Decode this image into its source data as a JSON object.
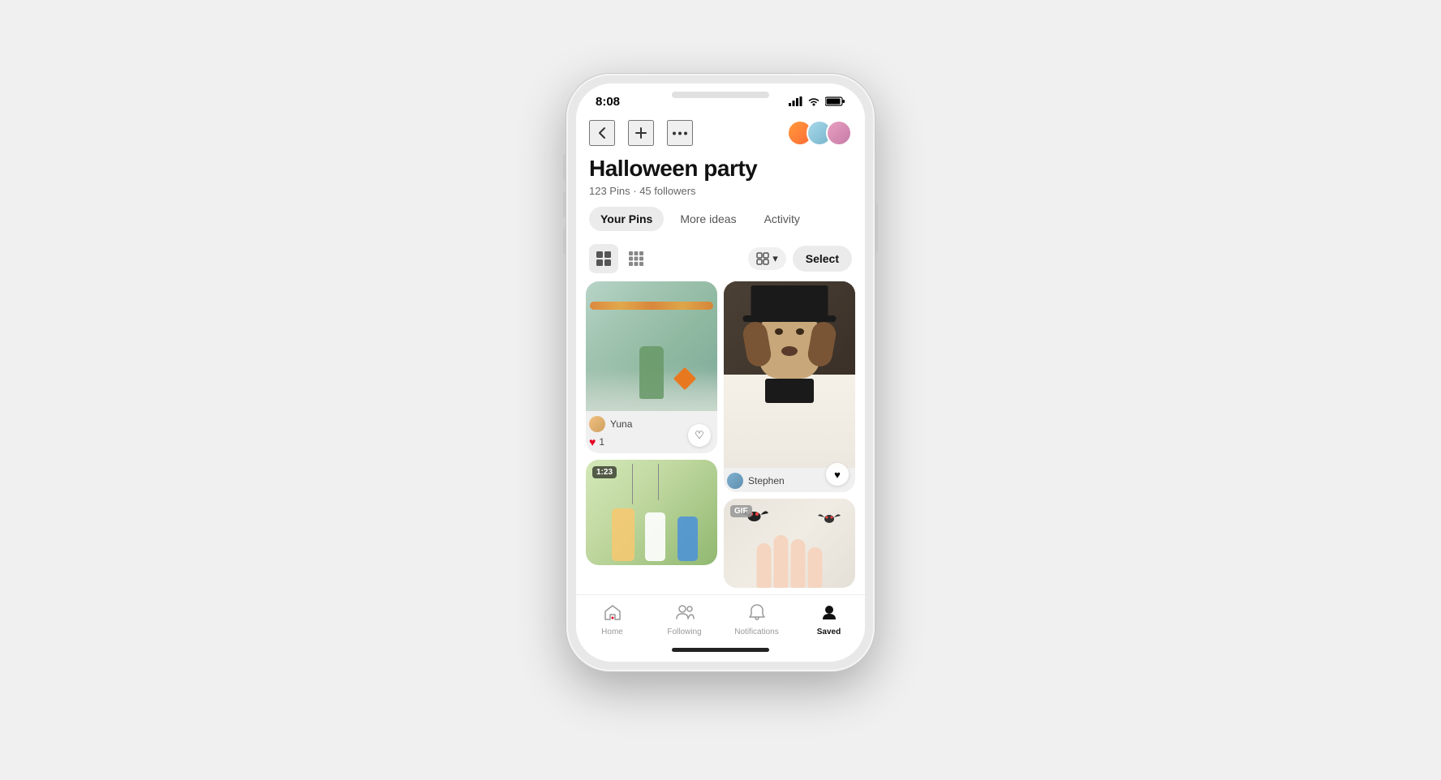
{
  "status_bar": {
    "time": "8:08",
    "signal": "▲▲▲",
    "wifi": "wifi",
    "battery": "battery"
  },
  "nav": {
    "back_label": "‹",
    "add_label": "+",
    "more_label": "•••",
    "avatars": [
      {
        "id": "avatar1",
        "color_class": "avatar-1"
      },
      {
        "id": "avatar2",
        "color_class": "avatar-2"
      },
      {
        "id": "avatar3",
        "color_class": "avatar-3"
      }
    ]
  },
  "board": {
    "title": "Halloween party",
    "pins_count": "123 Pins",
    "followers_count": "45 followers",
    "meta_separator": "·"
  },
  "tabs": [
    {
      "id": "your-pins",
      "label": "Your Pins",
      "active": true
    },
    {
      "id": "more-ideas",
      "label": "More ideas",
      "active": false
    },
    {
      "id": "activity",
      "label": "Activity",
      "active": false
    }
  ],
  "toolbar": {
    "view_large_label": "⊞",
    "view_small_label": "⊟",
    "sort_icon": "⧉",
    "sort_label": "Sort",
    "select_label": "Select"
  },
  "pins": [
    {
      "id": "pin1",
      "type": "image",
      "image_type": "kid-dino",
      "col": 0,
      "user_name": "Yuna",
      "user_avatar_class": "user-yuna",
      "likes": "1",
      "has_heart": true,
      "heart_filled": false,
      "video_badge": null,
      "gif_badge": null
    },
    {
      "id": "pin2",
      "type": "image",
      "image_type": "dog-hat",
      "col": 1,
      "user_name": "Stephen",
      "user_avatar_class": "user-stephen",
      "likes": null,
      "has_heart": true,
      "heart_filled": true,
      "video_badge": null,
      "gif_badge": null
    },
    {
      "id": "pin3",
      "type": "image",
      "image_type": "kids-play",
      "col": 0,
      "user_name": null,
      "user_avatar_class": null,
      "likes": null,
      "has_heart": false,
      "video_badge": "1:23",
      "gif_badge": null
    },
    {
      "id": "pin4",
      "type": "image",
      "image_type": "bats-gif",
      "col": 1,
      "user_name": null,
      "user_avatar_class": null,
      "likes": null,
      "has_heart": false,
      "video_badge": null,
      "gif_badge": "GIF"
    }
  ],
  "bottom_nav": {
    "items": [
      {
        "id": "home",
        "label": "Home",
        "icon": "⌂",
        "active": false
      },
      {
        "id": "following",
        "label": "Following",
        "icon": "👥",
        "active": false
      },
      {
        "id": "notifications",
        "label": "Notifications",
        "icon": "🔔",
        "active": false
      },
      {
        "id": "saved",
        "label": "Saved",
        "icon": "👤",
        "active": true
      }
    ]
  },
  "colors": {
    "accent": "#e60023",
    "active_tab_bg": "#ebebeb",
    "text_primary": "#111111",
    "text_secondary": "#666666"
  }
}
